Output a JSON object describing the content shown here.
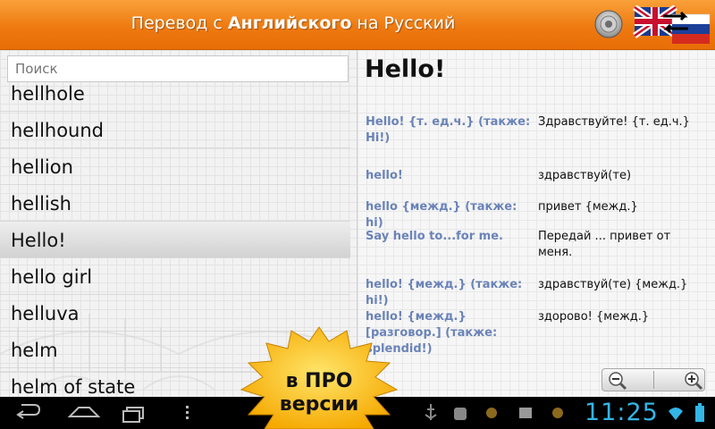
{
  "titlebar": {
    "title_prefix": "Перевод с ",
    "title_from": "Английского",
    "title_mid": " на ",
    "title_to": "Русский",
    "speaker_icon": "speaker-icon",
    "swap_icon": "swap-language-icon",
    "accent": "#ee7a10"
  },
  "search": {
    "placeholder": "Поиск"
  },
  "words": [
    {
      "text": "hellhole",
      "selected": false
    },
    {
      "text": "hellhound",
      "selected": false
    },
    {
      "text": "hellion",
      "selected": false
    },
    {
      "text": "hellish",
      "selected": false
    },
    {
      "text": "Hello!",
      "selected": true
    },
    {
      "text": "hello girl",
      "selected": false
    },
    {
      "text": "helluva",
      "selected": false
    },
    {
      "text": "helm",
      "selected": false
    },
    {
      "text": "helm of state",
      "selected": false
    }
  ],
  "entry": {
    "headword": "Hello!",
    "translations": [
      {
        "source": "Hello! {т. ед.ч.} (также: Hi!)",
        "target": "Здравствуйте! {т. ед.ч.}"
      },
      {
        "source": "hello!",
        "target": "здравствуй(те)"
      },
      {
        "source": "hello {межд.} (также: hi)",
        "target": "привет {межд.}"
      },
      {
        "source": "Say hello to...for me.",
        "target": "Передай ... привет от меня."
      },
      {
        "source": "hello! {межд.} (также: hi!)",
        "target": "здравствуй(те) {межд.}"
      },
      {
        "source": "hello! {межд.} [разговор.] (также: splendid!)",
        "target": "здорово! {межд.}"
      }
    ]
  },
  "pro_badge": {
    "line1": "в ПРО",
    "line2": "версии"
  },
  "statusbar": {
    "time": "11:25",
    "clock_color": "#33b5e5"
  }
}
